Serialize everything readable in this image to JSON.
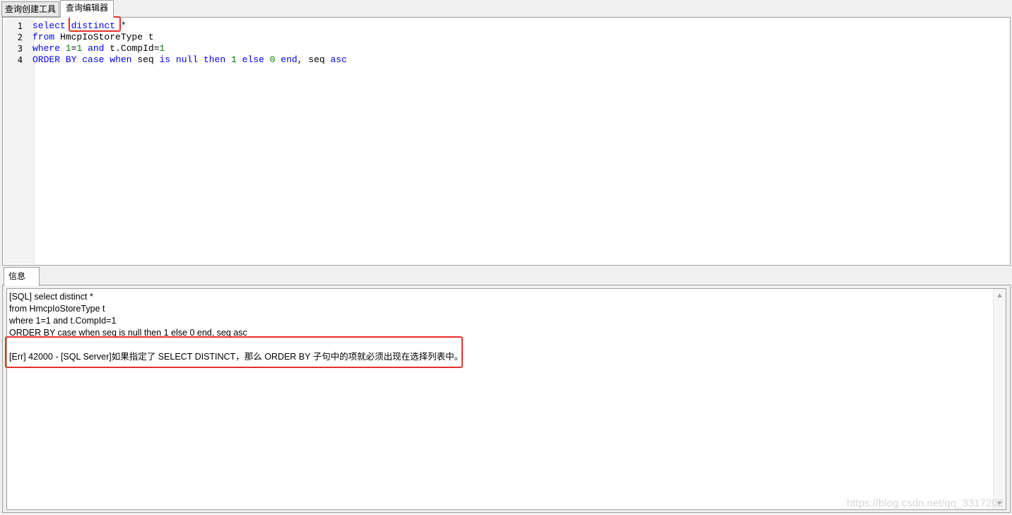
{
  "tabs": {
    "query_builder": "查询创建工具",
    "query_editor": "查询编辑器"
  },
  "editor": {
    "line_numbers": [
      "1",
      "2",
      "3",
      "4"
    ],
    "lines": [
      [
        {
          "t": "select",
          "c": "kw"
        },
        {
          "t": " ",
          "c": "op"
        },
        {
          "t": "distinct",
          "c": "kw"
        },
        {
          "t": " *",
          "c": "op"
        }
      ],
      [
        {
          "t": "from",
          "c": "kw"
        },
        {
          "t": " HmcpIoStoreType t",
          "c": "ident"
        }
      ],
      [
        {
          "t": "where",
          "c": "kw"
        },
        {
          "t": " ",
          "c": "op"
        },
        {
          "t": "1",
          "c": "num"
        },
        {
          "t": "=",
          "c": "op"
        },
        {
          "t": "1",
          "c": "num"
        },
        {
          "t": " ",
          "c": "op"
        },
        {
          "t": "and",
          "c": "kw"
        },
        {
          "t": " t.CompId=",
          "c": "ident"
        },
        {
          "t": "1",
          "c": "num"
        }
      ],
      [
        {
          "t": "ORDER BY",
          "c": "kw"
        },
        {
          "t": " ",
          "c": "op"
        },
        {
          "t": "case",
          "c": "kw"
        },
        {
          "t": " ",
          "c": "op"
        },
        {
          "t": "when",
          "c": "kw"
        },
        {
          "t": " seq ",
          "c": "ident"
        },
        {
          "t": "is",
          "c": "kw"
        },
        {
          "t": " ",
          "c": "op"
        },
        {
          "t": "null",
          "c": "kw"
        },
        {
          "t": " ",
          "c": "op"
        },
        {
          "t": "then",
          "c": "kw"
        },
        {
          "t": " ",
          "c": "op"
        },
        {
          "t": "1",
          "c": "num"
        },
        {
          "t": " ",
          "c": "op"
        },
        {
          "t": "else",
          "c": "kw"
        },
        {
          "t": " ",
          "c": "op"
        },
        {
          "t": "0",
          "c": "num"
        },
        {
          "t": " ",
          "c": "op"
        },
        {
          "t": "end",
          "c": "kw"
        },
        {
          "t": ", seq ",
          "c": "ident"
        },
        {
          "t": "asc",
          "c": "kw"
        }
      ]
    ]
  },
  "info": {
    "tab_label": "信息",
    "lines": [
      "[SQL] select distinct *",
      "from HmcpIoStoreType t",
      "where 1=1 and t.CompId=1",
      "ORDER BY case when seq is null then 1 else 0 end, seq asc",
      "",
      "[Err] 42000 - [SQL Server]如果指定了 SELECT DISTINCT，那么 ORDER BY 子句中的项就必须出现在选择列表中。"
    ]
  },
  "colors": {
    "keyword": "#0000ff",
    "number": "#008000",
    "annotation_box": "#e8302a"
  },
  "watermark": "https://blog.csdn.net/qq_3317202"
}
